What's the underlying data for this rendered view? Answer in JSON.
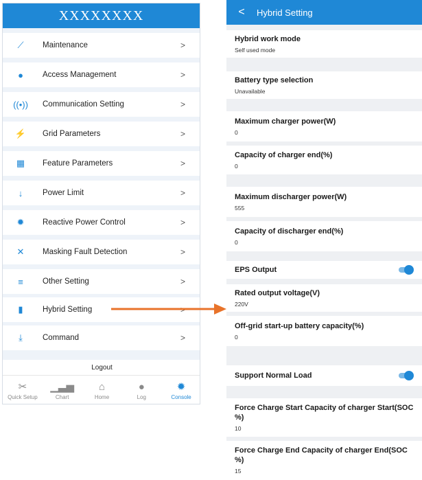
{
  "left_panel": {
    "title": "XXXXXXXX",
    "menu": [
      {
        "label": "Maintenance",
        "icon": "wrench-icon",
        "glyph": "⟋"
      },
      {
        "label": "Access Management",
        "icon": "user-icon",
        "glyph": "●"
      },
      {
        "label": "Communication Setting",
        "icon": "signal-icon",
        "glyph": "((•))"
      },
      {
        "label": "Grid Parameters",
        "icon": "lightning-icon",
        "glyph": "⚡"
      },
      {
        "label": "Feature Parameters",
        "icon": "grid-icon",
        "glyph": "▦"
      },
      {
        "label": "Power Limit",
        "icon": "arrow-down-icon",
        "glyph": "↓"
      },
      {
        "label": "Reactive Power Control",
        "icon": "gear-icon",
        "glyph": "✹"
      },
      {
        "label": "Masking Fault Detection",
        "icon": "masking-icon",
        "glyph": "✕"
      },
      {
        "label": "Other Setting",
        "icon": "list-icon",
        "glyph": "≡"
      },
      {
        "label": "Hybrid Setting",
        "icon": "battery-icon",
        "glyph": "▮"
      },
      {
        "label": "Command",
        "icon": "command-icon",
        "glyph": "⤓"
      }
    ],
    "chevron": ">",
    "logout_label": "Logout",
    "tabs": [
      {
        "label": "Quick Setup",
        "icon": "tools-icon",
        "glyph": "✂"
      },
      {
        "label": "Chart",
        "icon": "chart-icon",
        "glyph": "▁▃▅"
      },
      {
        "label": "Home",
        "icon": "home-icon",
        "glyph": "⌂"
      },
      {
        "label": "Log",
        "icon": "log-icon",
        "glyph": "●"
      },
      {
        "label": "Console",
        "icon": "console-icon",
        "glyph": "✹"
      }
    ],
    "active_tab": "Console"
  },
  "right_panel": {
    "back_icon": "<",
    "title": "Hybrid Setting",
    "fields": [
      {
        "label": "Hybrid work mode",
        "value": "Self used mode"
      },
      {
        "label": "Battery type selection",
        "value": "Unavailable"
      },
      {
        "label": "Maximum charger power(W)",
        "value": "0"
      },
      {
        "label": "Capacity of charger end(%)",
        "value": "0"
      },
      {
        "label": "Maximum discharger power(W)",
        "value": "555"
      },
      {
        "label": "Capacity of discharger end(%)",
        "value": "0"
      },
      {
        "label": "EPS Output",
        "toggle": true
      },
      {
        "label": "Rated output voltage(V)",
        "value": "220V"
      },
      {
        "label": "Off-grid start-up battery capacity(%)",
        "value": "0"
      },
      {
        "label": "Support Normal Load",
        "toggle": true
      },
      {
        "label": "Force Charge Start Capacity of charger Start(SOC %)",
        "value": "10"
      },
      {
        "label": "Force Charge End Capacity of charger End(SOC %)",
        "value": "15"
      }
    ]
  },
  "colors": {
    "accent": "#1f88d6",
    "arrow": "#e8732a"
  }
}
